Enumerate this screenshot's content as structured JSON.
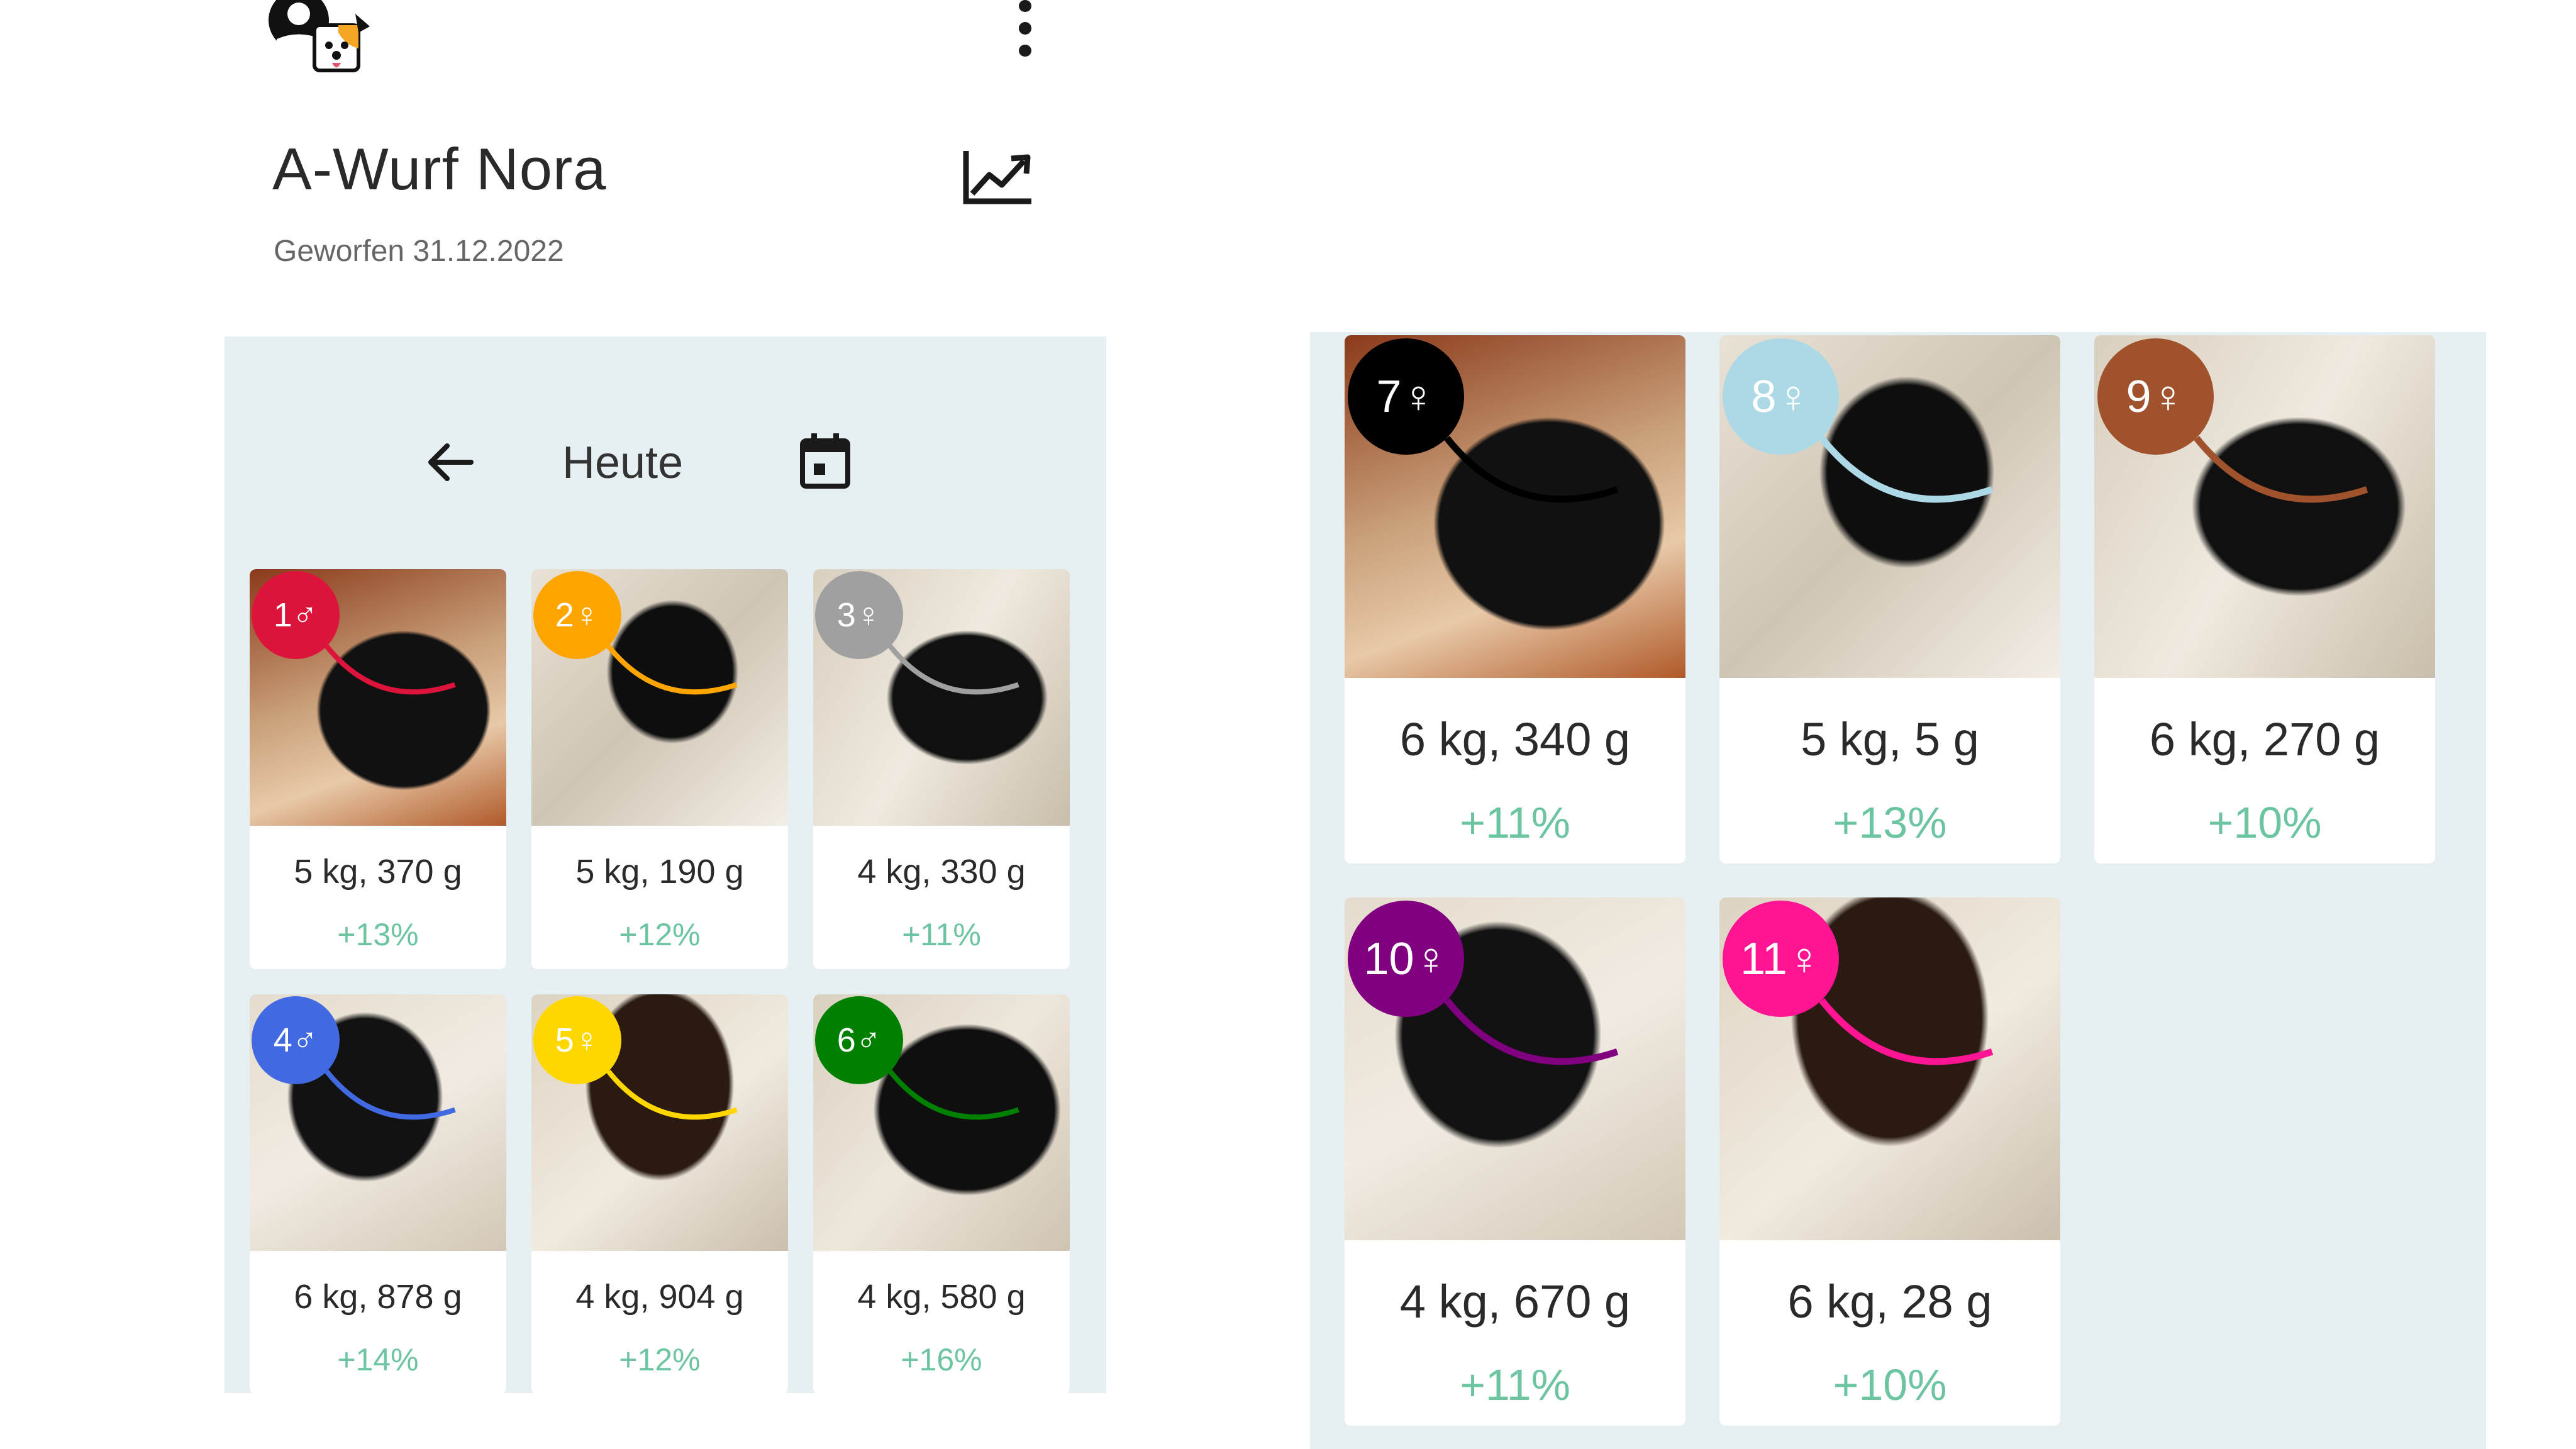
{
  "header": {
    "title": "A-Wurf Nora",
    "subtitle": "Geworfen 31.12.2022"
  },
  "icons": {
    "app_logo": "dog-avatar-logo",
    "more": "more-vert-icon",
    "chart": "trending-up-chart-icon",
    "back": "arrow-back-icon",
    "calendar": "calendar-icon"
  },
  "date_nav": {
    "label": "Heute"
  },
  "colors": {
    "panel_bg": "#e6f0f2",
    "percent": "#6cc5a0"
  },
  "puppies_left": [
    {
      "badge": "1♂",
      "color": "#dc143c",
      "weight": "5 kg, 370 g",
      "change": "+13%"
    },
    {
      "badge": "2♀",
      "color": "#ffa500",
      "weight": "5 kg, 190 g",
      "change": "+12%"
    },
    {
      "badge": "3♀",
      "color": "#a0a0a0",
      "weight": "4 kg, 330 g",
      "change": "+11%"
    },
    {
      "badge": "4♂",
      "color": "#4169e1",
      "weight": "6 kg, 878 g",
      "change": "+14%"
    },
    {
      "badge": "5♀",
      "color": "#ffd700",
      "weight": "4 kg, 904 g",
      "change": "+12%"
    },
    {
      "badge": "6♂",
      "color": "#008000",
      "weight": "4 kg, 580 g",
      "change": "+16%"
    }
  ],
  "puppies_right": [
    {
      "badge": "7♀",
      "color": "#000000",
      "weight": "6 kg, 340 g",
      "change": "+11%"
    },
    {
      "badge": "8♀",
      "color": "#add8e6",
      "weight": "5 kg, 5 g",
      "change": "+13%"
    },
    {
      "badge": "9♀",
      "color": "#a0522d",
      "weight": "6 kg, 270 g",
      "change": "+10%"
    },
    {
      "badge": "10♀",
      "color": "#800080",
      "weight": "4 kg, 670 g",
      "change": "+11%"
    },
    {
      "badge": "11♀",
      "color": "#ff1493",
      "weight": "6 kg, 28 g",
      "change": "+10%"
    }
  ]
}
